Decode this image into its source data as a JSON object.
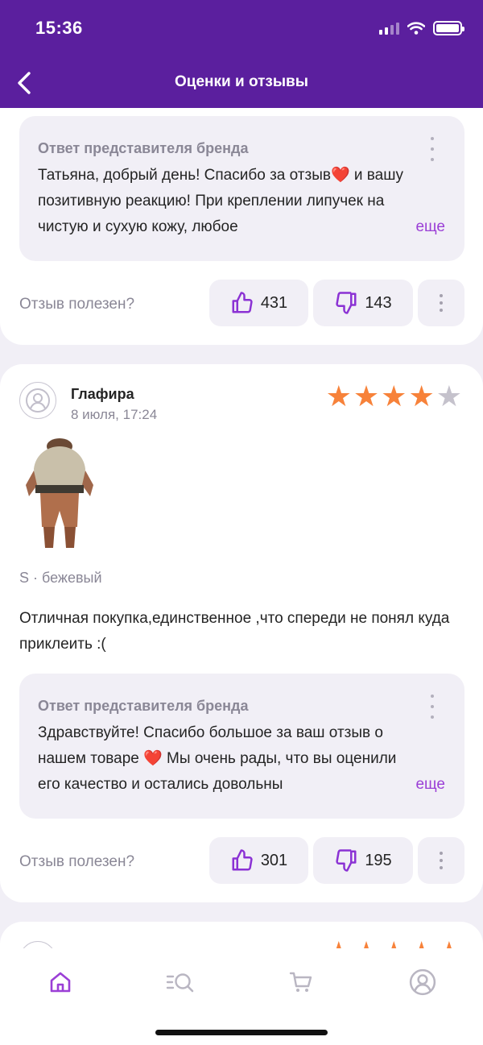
{
  "status_bar": {
    "time": "15:36"
  },
  "header": {
    "title": "Оценки и отзывы"
  },
  "reviews": [
    {
      "brand_reply": {
        "title": "Ответ представителя бренда",
        "text": "Татьяна, добрый день! Спасибо за отзыв❤️ и вашу позитивную реакцию! При креплении липучек на чистую и сухую кожу, любое",
        "more_label": "еще"
      },
      "helpful_label": "Отзыв полезен?",
      "likes": "431",
      "dislikes": "143"
    },
    {
      "author": "Глафира",
      "date": "8 июля, 17:24",
      "rating": 4,
      "rating_max": 5,
      "variant": "S · бежевый",
      "text": "Отличная покупка,единственное ,что спереди не понял куда приклеить :(",
      "brand_reply": {
        "title": "Ответ представителя бренда",
        "text": "Здравствуйте! Спасибо большое за ваш отзыв о нашем товаре ❤️ Мы очень рады, что вы оценили его качество и остались довольны",
        "more_label": "еще"
      },
      "helpful_label": "Отзыв полезен?",
      "likes": "301",
      "dislikes": "195"
    }
  ],
  "tab_bar": [
    {
      "icon": "home-icon",
      "active": true
    },
    {
      "icon": "catalog-search-icon",
      "active": false
    },
    {
      "icon": "cart-icon",
      "active": false
    },
    {
      "icon": "profile-icon",
      "active": false
    }
  ],
  "colors": {
    "brand": "#5b1f9e",
    "accent": "#9b3fd6",
    "star": "#f7823a"
  }
}
